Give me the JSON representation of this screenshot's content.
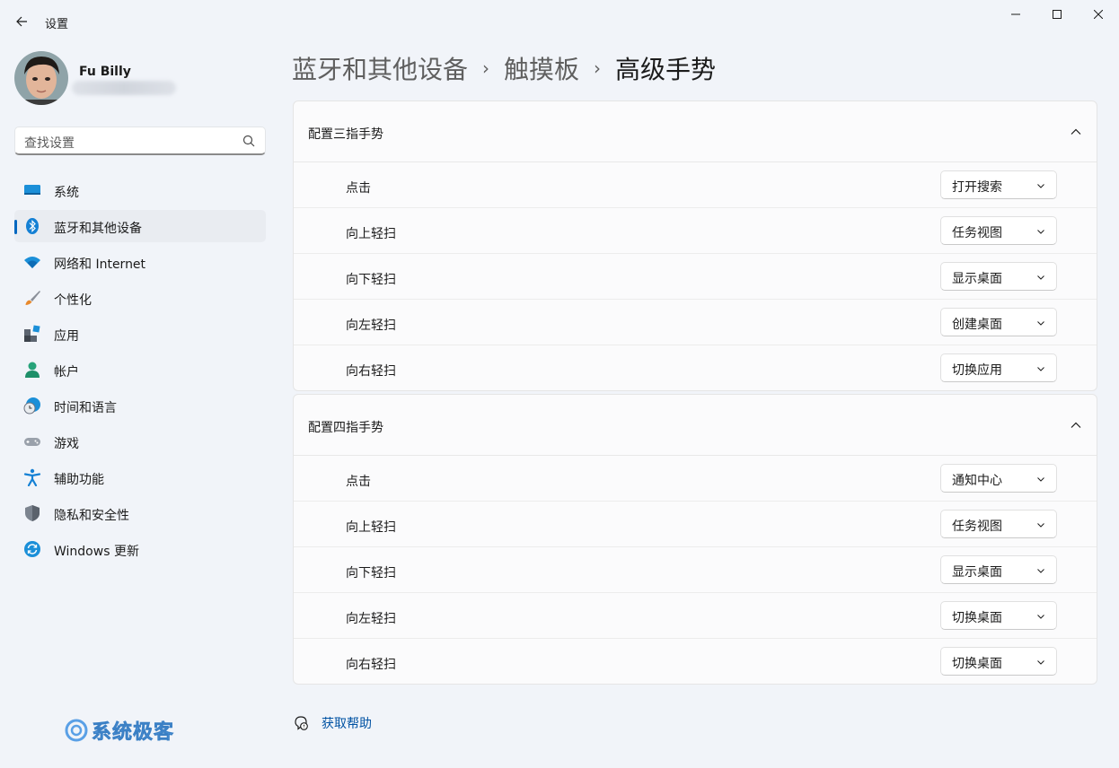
{
  "window": {
    "title": "设置"
  },
  "user": {
    "name": "Fu Billy"
  },
  "search": {
    "placeholder": "查找设置"
  },
  "sidebar": {
    "items": [
      {
        "label": "系统",
        "icon": "system-icon"
      },
      {
        "label": "蓝牙和其他设备",
        "icon": "bluetooth-icon",
        "active": true
      },
      {
        "label": "网络和 Internet",
        "icon": "wifi-icon"
      },
      {
        "label": "个性化",
        "icon": "brush-icon"
      },
      {
        "label": "应用",
        "icon": "apps-icon"
      },
      {
        "label": "帐户",
        "icon": "account-icon"
      },
      {
        "label": "时间和语言",
        "icon": "clock-globe-icon"
      },
      {
        "label": "游戏",
        "icon": "gamepad-icon"
      },
      {
        "label": "辅助功能",
        "icon": "accessibility-icon"
      },
      {
        "label": "隐私和安全性",
        "icon": "shield-icon"
      },
      {
        "label": "Windows 更新",
        "icon": "update-icon"
      }
    ]
  },
  "watermark": {
    "text": "系统极客"
  },
  "breadcrumb": {
    "parent1": "蓝牙和其他设备",
    "parent2": "触摸板",
    "current": "高级手势"
  },
  "three_finger": {
    "title": "配置三指手势",
    "rows": [
      {
        "label": "点击",
        "value": "打开搜索"
      },
      {
        "label": "向上轻扫",
        "value": "任务视图"
      },
      {
        "label": "向下轻扫",
        "value": "显示桌面"
      },
      {
        "label": "向左轻扫",
        "value": "创建桌面"
      },
      {
        "label": "向右轻扫",
        "value": "切换应用"
      }
    ]
  },
  "four_finger": {
    "title": "配置四指手势",
    "rows": [
      {
        "label": "点击",
        "value": "通知中心"
      },
      {
        "label": "向上轻扫",
        "value": "任务视图"
      },
      {
        "label": "向下轻扫",
        "value": "显示桌面"
      },
      {
        "label": "向左轻扫",
        "value": "切换桌面"
      },
      {
        "label": "向右轻扫",
        "value": "切换桌面"
      }
    ]
  },
  "help": {
    "label": "获取帮助"
  },
  "colors": {
    "accent": "#0067c0",
    "background": "#f1f4f9",
    "card": "#fbfbfc",
    "link": "#0052a3"
  }
}
